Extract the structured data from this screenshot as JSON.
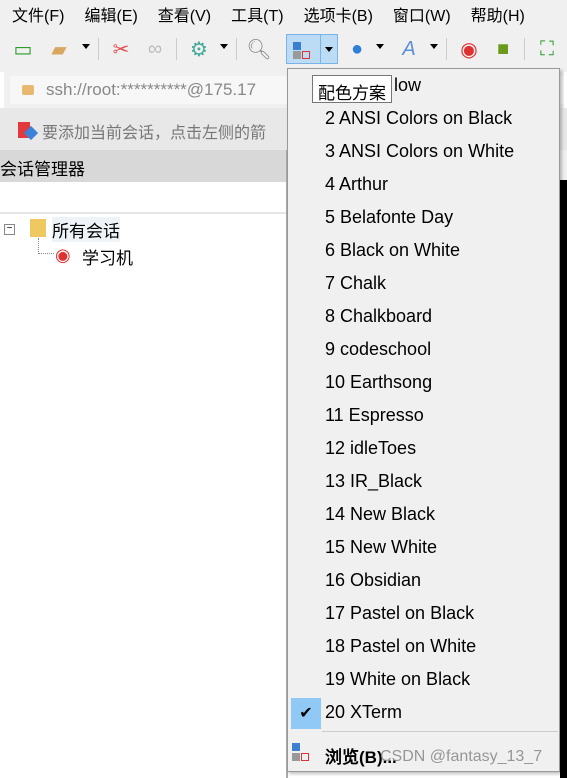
{
  "menubar": [
    "文件(F)",
    "编辑(E)",
    "查看(V)",
    "工具(T)",
    "选项卡(B)",
    "窗口(W)",
    "帮助(H)"
  ],
  "address": "ssh://root:**********@175.17",
  "hint": "要添加当前会话，点击左侧的箭",
  "panel": {
    "title": "会话管理器",
    "root": "所有会话",
    "child": "学习机"
  },
  "tooltip": "配色方案",
  "menu": {
    "first_visible": "low",
    "items": [
      "2 ANSI Colors on Black",
      "3 ANSI Colors on White",
      "4 Arthur",
      "5 Belafonte Day",
      "6 Black on White",
      "7 Chalk",
      "8 Chalkboard",
      "9 codeschool",
      "10 Earthsong",
      "11 Espresso",
      "12 idleToes",
      "13 IR_Black",
      "14 New Black",
      "15 New White",
      "16 Obsidian",
      "17 Pastel on Black",
      "18 Pastel on White",
      "19 White on Black",
      "20 XTerm"
    ],
    "checked": "20 XTerm",
    "browse": "浏览(B)..."
  },
  "watermark": "CSDN @fantasy_13_7",
  "colors": {
    "accent": "#90c8f6",
    "menu_bg": "#f0f0f0"
  }
}
